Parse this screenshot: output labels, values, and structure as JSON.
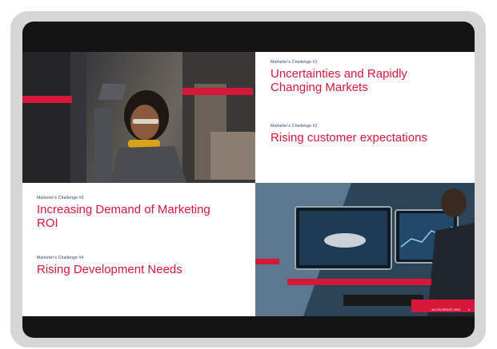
{
  "slide": {
    "challenges": [
      {
        "label": "Marketer's Challenge #1",
        "title_line1": "Uncertainties and Rapidly",
        "title_line2": "Changing Markets"
      },
      {
        "label": "Marketer's Challenge #2",
        "title_line1": "Rising customer expectations",
        "title_line2": ""
      },
      {
        "label": "Marketer's Challenge #3",
        "title_line1": "Increasing Demand of Marketing",
        "title_line2": "ROI"
      },
      {
        "label": "Marketer's Challenge #4",
        "title_line1": "Rising Development Needs",
        "title_line2": ""
      }
    ],
    "footer_brand": "ACCELERATE 2022",
    "footer_page": "6"
  },
  "colors": {
    "accent": "#d6173a",
    "label": "#1f3a6e"
  }
}
